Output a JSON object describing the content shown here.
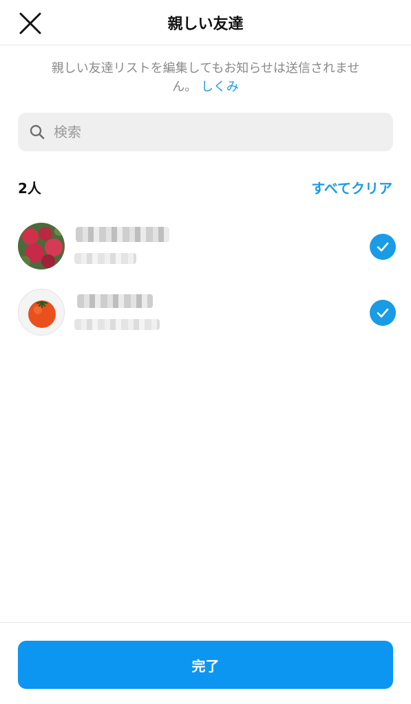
{
  "header": {
    "title": "親しい友達",
    "close_icon": "close-icon"
  },
  "notice": {
    "text": "親しい友達リストを編集してもお知らせは送信されません。",
    "link_label": "しくみ"
  },
  "search": {
    "placeholder": "検索",
    "value": ""
  },
  "list": {
    "count_label": "2人",
    "clear_all_label": "すべてクリア",
    "items": [
      {
        "avatar": "red-flowers-photo",
        "selected": true
      },
      {
        "avatar": "tomato-photo",
        "selected": true
      }
    ]
  },
  "footer": {
    "done_label": "完了"
  },
  "colors": {
    "accent": "#1a9be6",
    "button": "#0d95f2",
    "search_bg": "#efefef",
    "muted_text": "#8a8a8a"
  }
}
